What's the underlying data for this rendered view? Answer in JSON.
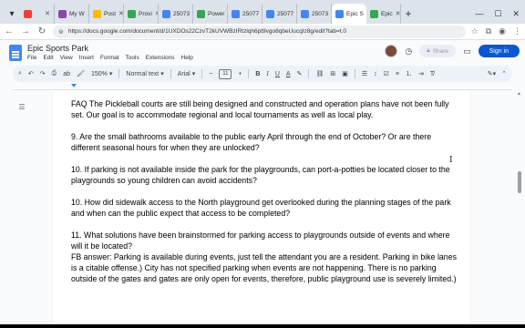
{
  "tabs": [
    {
      "label": "",
      "color": "#ea4335"
    },
    {
      "label": "My W",
      "color": "#8e44ad"
    },
    {
      "label": "Post",
      "color": "#fbbc04"
    },
    {
      "label": "Provi",
      "color": "#34a853"
    },
    {
      "label": "25073",
      "color": "#4285f4"
    },
    {
      "label": "Power",
      "color": "#34a853"
    },
    {
      "label": "25077",
      "color": "#4285f4"
    },
    {
      "label": "25077",
      "color": "#4285f4"
    },
    {
      "label": "25073",
      "color": "#4285f4"
    },
    {
      "label": "Epic S",
      "color": "#4285f4",
      "active": true
    },
    {
      "label": "Epic",
      "color": "#34a853"
    }
  ],
  "address": {
    "url": "https://docs.google.com/document/d/1UXDOs22CzvT2kUVWBzIRtzlqh6pt9vgo8qbeUucqIz8g/edit?tab=t.0"
  },
  "docs": {
    "title": "Epic Sports Park",
    "menu": [
      "File",
      "Edit",
      "View",
      "Insert",
      "Format",
      "Tools",
      "Extensions",
      "Help"
    ],
    "share_label": "Share",
    "signin_label": "Sign in"
  },
  "toolbar": {
    "zoom": "150%",
    "style": "Normal text",
    "font": "Arial",
    "size": "11"
  },
  "document": {
    "paragraphs": [
      {
        "id": "faq",
        "prefix": "FAQ",
        "text": " The Pickleball courts are still being designed and constructed and operation plans have not been fully set. Our goal is to accommodate regional and local tournaments as well as local play."
      },
      {
        "id": "q9",
        "text": "9. Are the small bathrooms available to the public early April through the end of October? Or are there different seasonal hours for when they are unlocked?"
      },
      {
        "id": "q10a",
        "text": "10. If parking is not available inside the park for the playgrounds, can port-a-potties be located closer to the playgrounds so young children can avoid accidents?"
      },
      {
        "id": "q10b",
        "text": "10. How did sidewalk access to the North playground get overlooked during the planning stages of the park and when can the public expect that access to be completed?"
      },
      {
        "id": "q11",
        "text": "11. What solutions have been brainstormed for parking access to playgrounds outside of events and where will it be located?"
      },
      {
        "id": "fb",
        "text": "FB answer: Parking is available during events, just tell the attendant you are a resident. Parking in bike lanes is a citable offense.) City has not specified parking when events are not happening. There is no parking outside of the gates and gates are only open for events, therefore, public playground use is severely limited.)"
      }
    ]
  }
}
